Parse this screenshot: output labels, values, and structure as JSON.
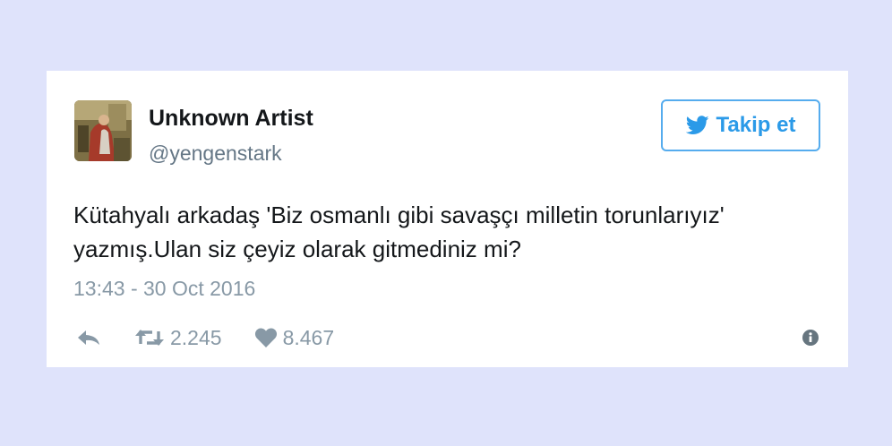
{
  "tweet": {
    "author": {
      "display_name": "Unknown Artist",
      "handle": "@yengenstark"
    },
    "follow_button": {
      "label": "Takip et",
      "icon": "twitter-bird-icon"
    },
    "text": "Kütahyalı arkadaş 'Biz osmanlı gibi savaşçı milletin torunlarıyız' yazmış.Ulan siz çeyiz olarak gitmediniz mi?",
    "timestamp": "13:43 - 30 Oct 2016",
    "actions": {
      "reply": {
        "icon": "reply-icon"
      },
      "retweet": {
        "icon": "retweet-icon",
        "count": "2.245"
      },
      "like": {
        "icon": "heart-icon",
        "count": "8.467"
      },
      "info": {
        "icon": "info-icon"
      }
    }
  },
  "colors": {
    "background": "#dfe3fb",
    "card": "#ffffff",
    "text_primary": "#14171a",
    "text_secondary": "#8899a6",
    "accent": "#55acee"
  }
}
